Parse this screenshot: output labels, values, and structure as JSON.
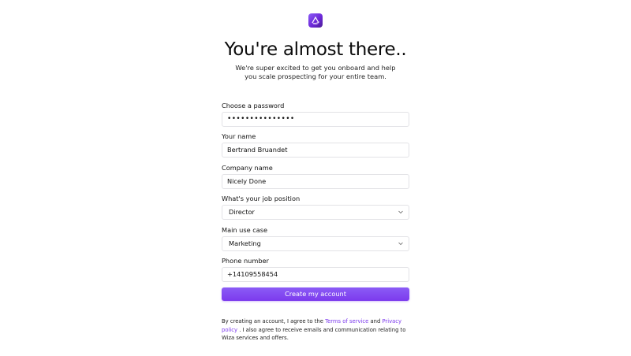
{
  "header": {
    "title": "You're almost there..",
    "subtitle": "We're super excited to get you onboard and help you scale prospecting for your entire team."
  },
  "form": {
    "password": {
      "label": "Choose a password",
      "value": "•••••••••••••••"
    },
    "name": {
      "label": "Your name",
      "value": "Bertrand Bruandet"
    },
    "company": {
      "label": "Company name",
      "value": "Nicely Done"
    },
    "job": {
      "label": "What's your job position",
      "value": "Director"
    },
    "use_case": {
      "label": "Main use case",
      "value": "Marketing"
    },
    "phone": {
      "label": "Phone number",
      "value": "+14109558454"
    },
    "submit_label": "Create my account"
  },
  "terms": {
    "prefix": "By creating an account, I agree to the",
    "terms_link": "Terms of service",
    "and": "and",
    "privacy_link": "Privacy policy",
    "suffix": ". I also agree to receive emails and communication relating to Wiza services and offers."
  },
  "colors": {
    "accent": "#7c3aed",
    "border": "#e2e2e6"
  },
  "icons": {
    "logo": "wiza-logo-icon",
    "dropdown": "chevron-down-icon"
  }
}
